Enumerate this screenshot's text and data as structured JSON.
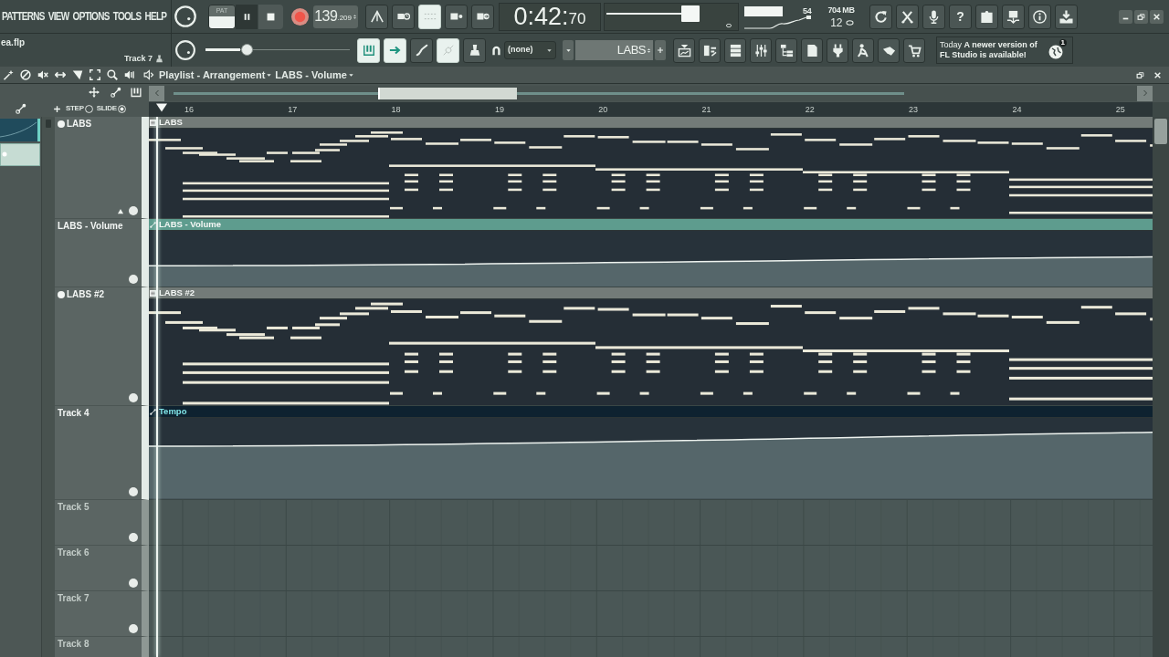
{
  "menu": [
    {
      "label": "PATTERNS"
    },
    {
      "label": "VIEW"
    },
    {
      "label": "OPTIONS"
    },
    {
      "label": "TOOLS"
    },
    {
      "label": "HELP"
    }
  ],
  "project": {
    "file": "ea.flp",
    "hint": "Track 7"
  },
  "transport": {
    "mode": [
      {
        "label": "PAT",
        "selected": false
      },
      {
        "selected": true
      }
    ],
    "tempo_whole": "139",
    "tempo_fraction": ".209",
    "record_options": [
      {
        "on": false
      },
      {
        "on": false
      },
      {
        "on": true
      },
      {
        "on": false
      },
      {
        "on": false
      }
    ]
  },
  "time": {
    "main": "0:42:",
    "fraction": "70"
  },
  "master_volume": {
    "level": 0.6
  },
  "master_pitch": {
    "level": 0.27
  },
  "monitor": {
    "cpu": "54",
    "memory": "704 MB",
    "polyphony": "12"
  },
  "help_button": "?",
  "tools": [
    {
      "on": true
    },
    {
      "on": true
    },
    {
      "on": false
    },
    {
      "on": true
    },
    {
      "on": false
    }
  ],
  "snap": {
    "value": "(none)"
  },
  "pattern": {
    "name": "LABS"
  },
  "news": {
    "text": "Today **A newer version of FL Studio is available!**",
    "badge": "1"
  },
  "playlist": {
    "title": "Playlist - Arrangement",
    "target": "LABS - Volume",
    "toggles": [
      {
        "label": "STEP",
        "on": false
      },
      {
        "label": "SLIDE",
        "on": true
      }
    ],
    "bars": [
      "16",
      "17",
      "18",
      "19",
      "20",
      "21",
      "22",
      "23",
      "24",
      "25"
    ],
    "tracks": [
      {
        "name": "LABS",
        "indicator": true,
        "hovered": true,
        "clips": [
          {
            "kind": "pattern",
            "label": "LABS",
            "color": "#737b78",
            "selected": false
          }
        ]
      },
      {
        "name": "LABS - Volume",
        "indicator": false,
        "hovered": false,
        "clips": [
          {
            "kind": "automation",
            "label": "LABS - Volume",
            "color": "#5e9c8e",
            "selected": false
          }
        ]
      },
      {
        "name": "LABS #2",
        "indicator": true,
        "hovered": false,
        "clips": [
          {
            "kind": "pattern",
            "label": "LABS #2",
            "color": "#737b78",
            "selected": false
          }
        ]
      },
      {
        "name": "Track 4",
        "indicator": false,
        "hovered": false,
        "clips": [
          {
            "kind": "automation",
            "label": "Tempo",
            "color": "#0e2230",
            "selected": true
          }
        ]
      },
      {
        "name": "Track 5",
        "indicator": false,
        "hovered": false
      },
      {
        "name": "Track 6",
        "indicator": false,
        "hovered": false
      },
      {
        "name": "Track 7",
        "indicator": false,
        "hovered": false
      },
      {
        "name": "Track 8",
        "indicator": false,
        "hovered": false
      }
    ]
  }
}
